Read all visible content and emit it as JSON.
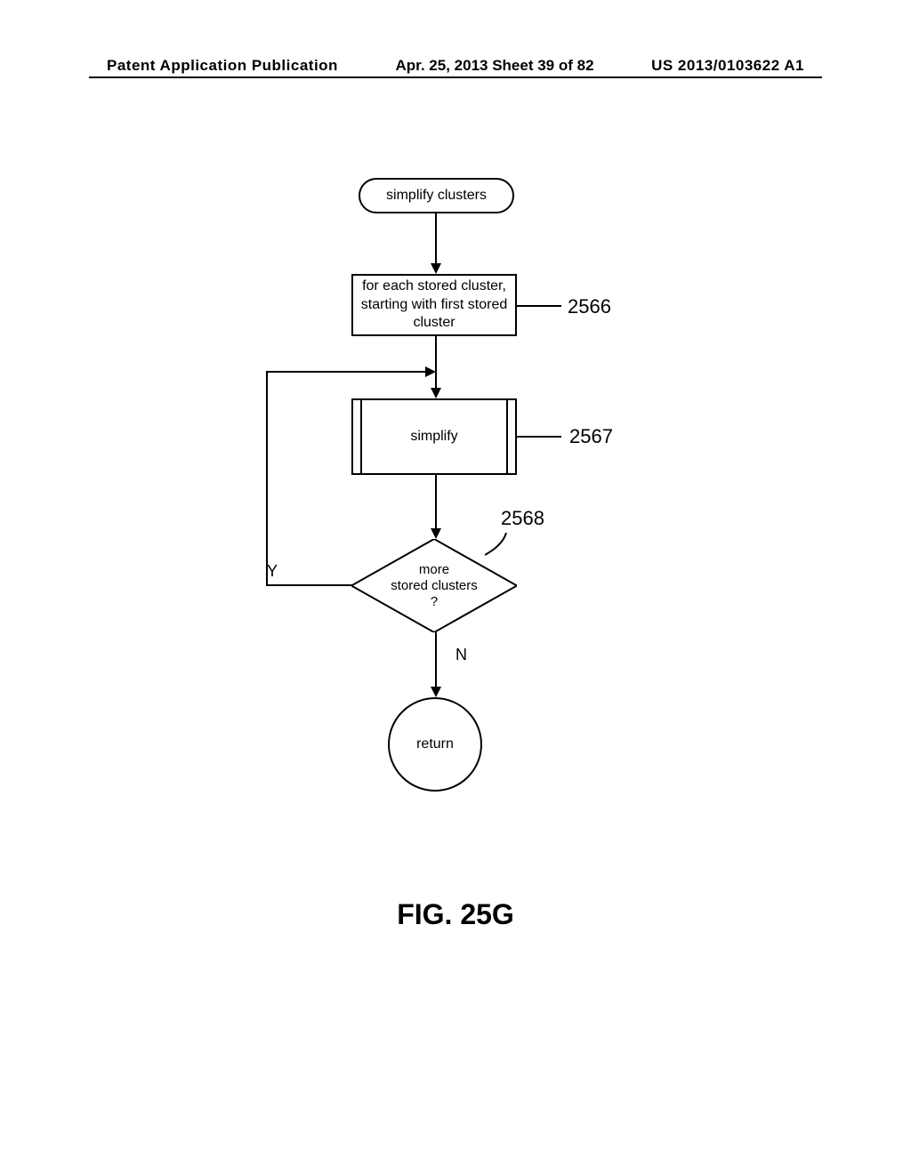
{
  "header": {
    "left": "Patent Application Publication",
    "center": "Apr. 25, 2013  Sheet 39 of 82",
    "right": "US 2013/0103622 A1"
  },
  "flow": {
    "start": "simplify clusters",
    "process1": "for each stored cluster, starting with first stored cluster",
    "subprocess": "simplify",
    "decision_line1": "more",
    "decision_line2": "stored clusters",
    "decision_line3": "?",
    "return": "return",
    "yes": "Y",
    "no": "N"
  },
  "refs": {
    "r1": "2566",
    "r2": "2567",
    "r3": "2568"
  },
  "figure": "FIG. 25G"
}
